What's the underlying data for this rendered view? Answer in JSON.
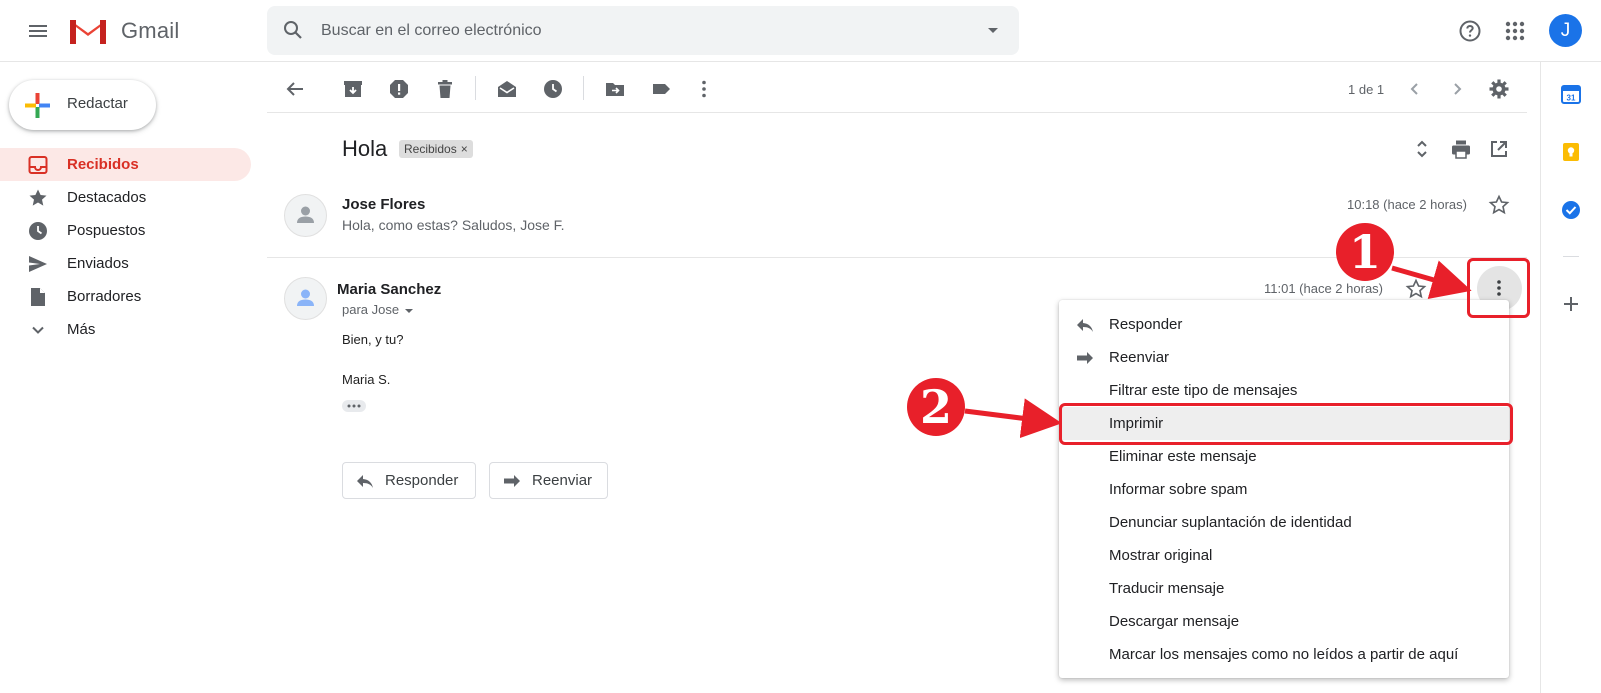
{
  "app": {
    "brand": "Gmail"
  },
  "search": {
    "placeholder": "Buscar en el correo electrónico"
  },
  "user": {
    "initial": "J",
    "avatar_color": "#1a73e8"
  },
  "compose": {
    "label": "Redactar"
  },
  "sidebar": {
    "items": [
      {
        "label": "Recibidos",
        "icon": "inbox-icon",
        "active": true
      },
      {
        "label": "Destacados",
        "icon": "star-icon"
      },
      {
        "label": "Pospuestos",
        "icon": "clock-icon"
      },
      {
        "label": "Enviados",
        "icon": "send-icon"
      },
      {
        "label": "Borradores",
        "icon": "draft-icon"
      },
      {
        "label": "Más",
        "icon": "chevron-down-icon"
      }
    ]
  },
  "toolbar": {
    "pager": "1 de 1"
  },
  "thread": {
    "subject": "Hola",
    "label_chip": "Recibidos",
    "label_chip_close": "×",
    "messages": [
      {
        "sender": "Jose Flores",
        "snippet": "Hola, como estas? Saludos, Jose F.",
        "time": "10:18 (hace 2 horas)"
      },
      {
        "sender": "Maria Sanchez",
        "to": "para Jose",
        "time": "11:01 (hace 2 horas)",
        "body": [
          "Bien, y tu?",
          "Maria S."
        ]
      }
    ],
    "reply_label": "Responder",
    "forward_label": "Reenviar"
  },
  "menu": {
    "items": [
      {
        "label": "Responder",
        "icon": "reply-icon"
      },
      {
        "label": "Reenviar",
        "icon": "forward-icon"
      },
      {
        "label": "Filtrar este tipo de mensajes"
      },
      {
        "label": "Imprimir",
        "highlighted": true
      },
      {
        "label": "Eliminar este mensaje"
      },
      {
        "label": "Informar sobre spam"
      },
      {
        "label": "Denunciar suplantación de identidad"
      },
      {
        "label": "Mostrar original"
      },
      {
        "label": "Traducir mensaje"
      },
      {
        "label": "Descargar mensaje"
      },
      {
        "label": "Marcar los mensajes como no leídos a partir de aquí"
      }
    ]
  },
  "annotations": {
    "step1": "1",
    "step2": "2",
    "color": "#e8202a"
  },
  "colors": {
    "active_nav_bg": "#fce8e6",
    "active_nav_text": "#d93025"
  }
}
